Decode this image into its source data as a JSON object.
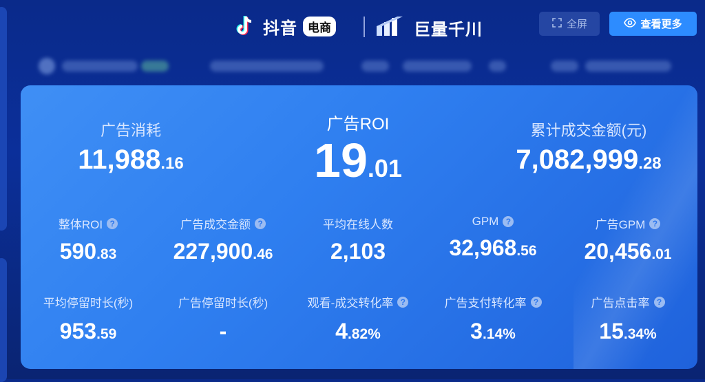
{
  "header": {
    "douyin_text": "抖音",
    "ec_badge": "电商",
    "qianchuan_text": "巨量千川",
    "fullscreen_label": "全屏",
    "more_label": "查看更多"
  },
  "hero": [
    {
      "label": "广告消耗",
      "int": "11,988",
      "dec": ".16"
    },
    {
      "label": "广告ROI",
      "int": "19",
      "dec": ".01"
    },
    {
      "label": "累计成交金额(元)",
      "int": "7,082,999",
      "dec": ".28"
    }
  ],
  "row1": [
    {
      "label": "整体ROI",
      "int": "590",
      "dec": ".83",
      "help": true
    },
    {
      "label": "广告成交金额",
      "int": "227,900",
      "dec": ".46",
      "help": true
    },
    {
      "label": "平均在线人数",
      "int": "2,103",
      "dec": "",
      "help": false
    },
    {
      "label": "GPM",
      "int": "32,968",
      "dec": ".56",
      "help": true
    },
    {
      "label": "广告GPM",
      "int": "20,456",
      "dec": ".01",
      "help": true
    }
  ],
  "row2": [
    {
      "label": "平均停留时长(秒)",
      "int": "953",
      "dec": ".59",
      "help": false
    },
    {
      "label": "广告停留时长(秒)",
      "int": "-",
      "dec": "",
      "help": false
    },
    {
      "label": "观看-成交转化率",
      "int": "4",
      "dec": ".82%",
      "help": true
    },
    {
      "label": "广告支付转化率",
      "int": "3",
      "dec": ".14%",
      "help": true
    },
    {
      "label": "广告点击率",
      "int": "15",
      "dec": ".34%",
      "help": true
    }
  ],
  "help_glyph": "?",
  "icons": [
    "tiktok-icon",
    "qianchuan-icon",
    "expand-icon",
    "eye-icon",
    "help-icon"
  ],
  "colors": {
    "card_start": "#3f8ff5",
    "card_end": "#1f62dc",
    "button_blue": "#2d8cff",
    "background": "#0a2a8a"
  }
}
